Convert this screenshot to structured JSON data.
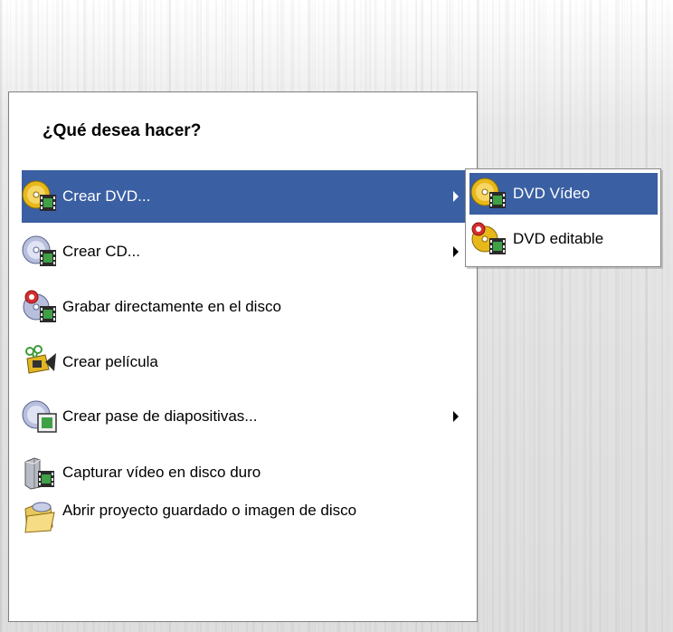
{
  "panel": {
    "title": "¿Qué desea hacer?",
    "items": [
      {
        "label": "Crear DVD...",
        "icon": "dvd-film-icon",
        "submenu": true,
        "selected": true
      },
      {
        "label": "Crear CD...",
        "icon": "cd-film-icon",
        "submenu": true,
        "selected": false
      },
      {
        "label": "Grabar directamente en el disco",
        "icon": "direct-burn-icon",
        "submenu": false,
        "selected": false
      },
      {
        "label": "Crear película",
        "icon": "movie-maker-icon",
        "submenu": false,
        "selected": false
      },
      {
        "label": "Crear pase de diapositivas...",
        "icon": "slideshow-disc-icon",
        "submenu": true,
        "selected": false
      },
      {
        "label": "Capturar vídeo en disco duro",
        "icon": "capture-video-icon",
        "submenu": false,
        "selected": false
      },
      {
        "label": "Abrir proyecto guardado o imagen de disco",
        "icon": "open-folder-icon",
        "submenu": false,
        "selected": false
      }
    ]
  },
  "submenu": {
    "items": [
      {
        "label": "DVD Vídeo",
        "icon": "dvd-video-icon",
        "selected": true
      },
      {
        "label": "DVD editable",
        "icon": "dvd-editable-icon",
        "selected": false
      }
    ]
  },
  "colors": {
    "selection": "#3a5fa3",
    "disc_gold": "#e8b81a",
    "disc_silver": "#b8bfdc"
  }
}
